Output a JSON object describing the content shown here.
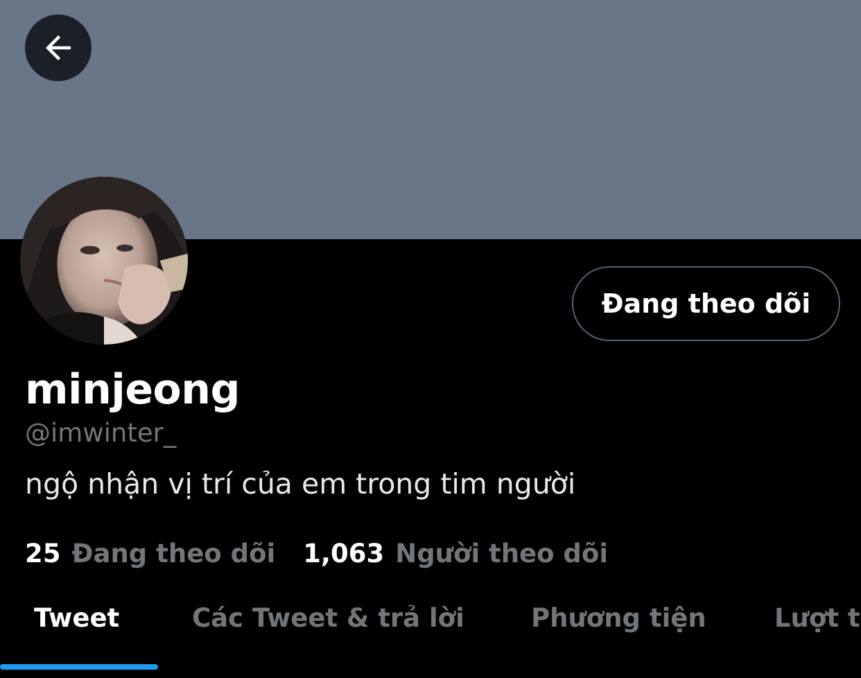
{
  "colors": {
    "banner": "#687687",
    "accent": "#1d9bf0",
    "muted": "#71767b",
    "background": "#000000"
  },
  "header": {
    "back_icon": "arrow-left-icon"
  },
  "profile": {
    "follow_button_label": "Đang theo dõi",
    "display_name": "minjeong",
    "handle": "@imwinter_",
    "bio": "ngộ nhận vị trí của em trong tim người"
  },
  "stats": {
    "following_count": "25",
    "following_label": "Đang theo dõi",
    "followers_count": "1,063",
    "followers_label": "Người theo dõi"
  },
  "tabs": [
    {
      "label": "Tweet",
      "active": true
    },
    {
      "label": "Các Tweet & trả lời",
      "active": false
    },
    {
      "label": "Phương tiện",
      "active": false
    },
    {
      "label": "Lượt thích",
      "active": false
    }
  ]
}
